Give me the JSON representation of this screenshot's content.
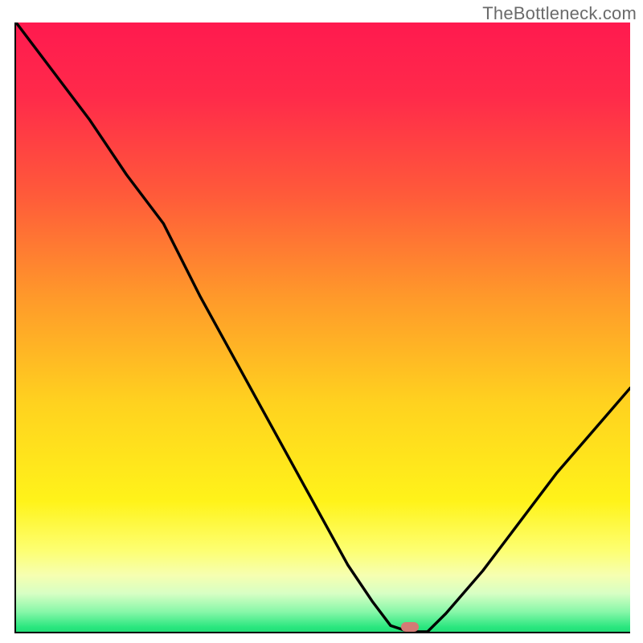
{
  "watermark": "TheBottleneck.com",
  "colors": {
    "gradient_stops": [
      {
        "pos": 0.0,
        "color": "#ff1a4f"
      },
      {
        "pos": 0.12,
        "color": "#ff2a4a"
      },
      {
        "pos": 0.28,
        "color": "#ff5a3a"
      },
      {
        "pos": 0.45,
        "color": "#ff9a2a"
      },
      {
        "pos": 0.62,
        "color": "#ffd21f"
      },
      {
        "pos": 0.78,
        "color": "#fff31a"
      },
      {
        "pos": 0.86,
        "color": "#fdff72"
      },
      {
        "pos": 0.9,
        "color": "#f6ffb0"
      },
      {
        "pos": 0.93,
        "color": "#d7ffc4"
      },
      {
        "pos": 0.96,
        "color": "#86f7a8"
      },
      {
        "pos": 0.985,
        "color": "#29e67e"
      },
      {
        "pos": 1.0,
        "color": "#1fd773"
      }
    ],
    "curve": "#000000",
    "marker": "#d37a75"
  },
  "marker": {
    "x_pct": 64.2,
    "y_pct": 99.2
  },
  "chart_data": {
    "type": "line",
    "title": "",
    "xlabel": "",
    "ylabel": "",
    "xlim": [
      0,
      100
    ],
    "ylim": [
      0,
      100
    ],
    "series": [
      {
        "name": "bottleneck-curve",
        "x": [
          0,
          6,
          12,
          18,
          24,
          30,
          36,
          42,
          48,
          54,
          58,
          61,
          64,
          67,
          70,
          76,
          82,
          88,
          94,
          100
        ],
        "y": [
          100,
          92,
          84,
          75,
          67,
          55,
          44,
          33,
          22,
          11,
          5,
          1,
          0,
          0,
          3,
          10,
          18,
          26,
          33,
          40
        ]
      }
    ],
    "annotations": [
      {
        "type": "marker",
        "x": 64.2,
        "y": 0.8,
        "label": "optimal-point"
      }
    ]
  }
}
